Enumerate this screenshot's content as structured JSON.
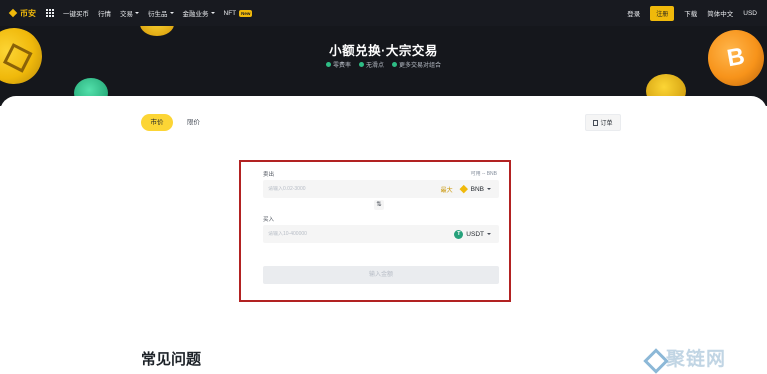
{
  "nav": {
    "brand": "币安",
    "items": [
      {
        "label": "一键买币",
        "dropdown": false
      },
      {
        "label": "行情",
        "dropdown": false
      },
      {
        "label": "交易",
        "dropdown": true
      },
      {
        "label": "衍生品",
        "dropdown": true
      },
      {
        "label": "金融业务",
        "dropdown": true
      },
      {
        "label": "NFT",
        "dropdown": false,
        "badge": "New"
      }
    ],
    "login": "登录",
    "register": "注册",
    "download": "下载",
    "language": "简体中文",
    "currency": "USD"
  },
  "hero": {
    "title": "小额兑换·大宗交易",
    "features": [
      "零费率",
      "无滑点",
      "更多交易对组合"
    ],
    "coin_btc_symbol": "B"
  },
  "tabs": {
    "market": "市价",
    "limit": "限价"
  },
  "orders_button": "订单",
  "swap": {
    "sell_label": "卖出",
    "available": "可用 -- BNB",
    "sell_placeholder": "请输入0.02-3000",
    "max": "最大",
    "sell_token": "BNB",
    "switch_icon": "⇅",
    "buy_label": "买入",
    "buy_placeholder": "请输入10-400000",
    "buy_token": "USDT",
    "usdt_symbol": "T",
    "submit": "输入金额"
  },
  "faq_title": "常见问题",
  "watermark": "聚链网",
  "colors": {
    "accent": "#fcd535",
    "brand": "#f0b90b",
    "nav_bg": "#181a20",
    "highlight_border": "#b22222",
    "usdt": "#26a17b"
  }
}
